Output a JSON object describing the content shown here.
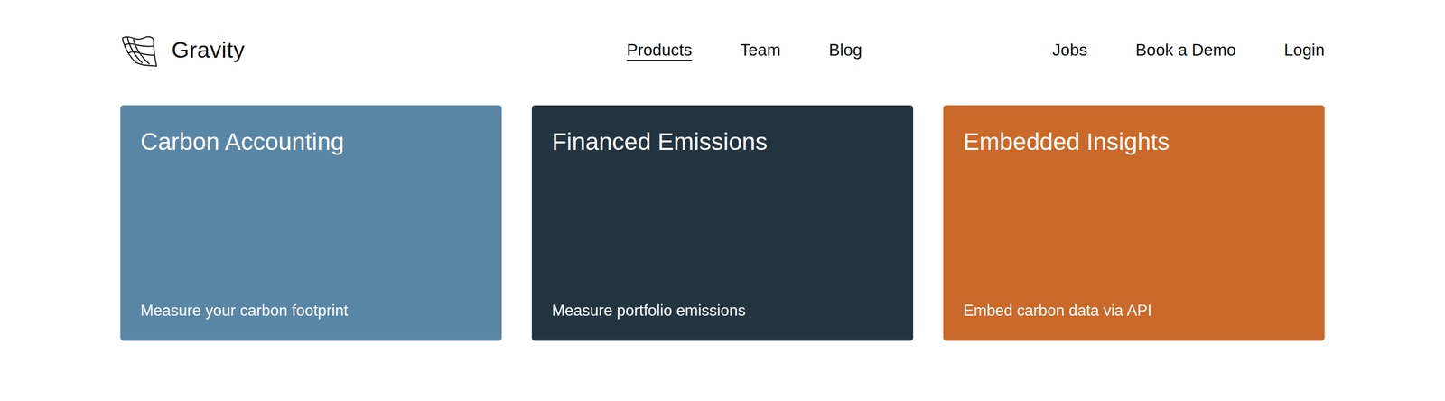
{
  "brand": {
    "name": "Gravity"
  },
  "nav": {
    "links": [
      {
        "label": "Products",
        "selected": true
      },
      {
        "label": "Team",
        "selected": false
      },
      {
        "label": "Blog",
        "selected": false
      }
    ],
    "actions": [
      {
        "label": "Jobs"
      },
      {
        "label": "Book a Demo"
      },
      {
        "label": "Login"
      }
    ]
  },
  "products": [
    {
      "title": "Carbon Accounting",
      "subtitle": "Measure your carbon footprint",
      "color": "#5a86a6"
    },
    {
      "title": "Financed Emissions",
      "subtitle": "Measure portfolio emissions",
      "color": "#23343f"
    },
    {
      "title": "Embedded Insights",
      "subtitle": "Embed carbon data via API",
      "color": "#c9692a"
    }
  ]
}
